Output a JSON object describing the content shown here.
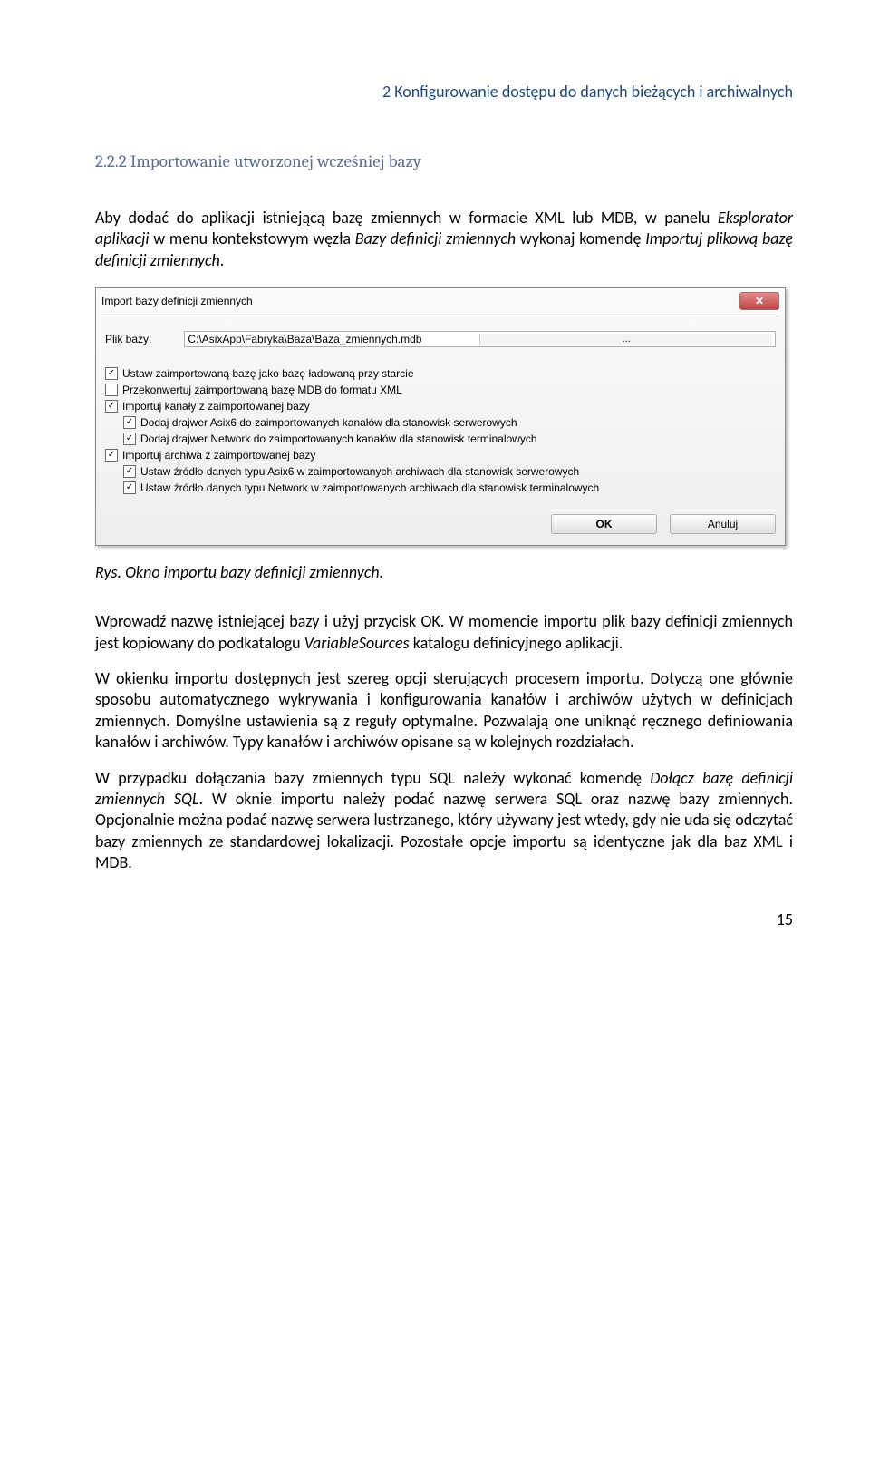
{
  "header": "2 Konfigurowanie dostępu do danych bieżących i archiwalnych",
  "section_title": "2.2.2 Importowanie utworzonej wcześniej bazy",
  "intro": "Aby dodać do aplikacji istniejącą bazę zmiennych w formacie XML lub MDB, w panelu Eksplorator aplikacji w menu kontekstowym węzła Bazy definicji zmiennych wykonaj komendę Importuj plikową bazę definicji zmiennych.",
  "dialog": {
    "title": "Import bazy definicji zmiennych",
    "file_label": "Plik bazy:",
    "file_value": "C:\\AsixApp\\Fabryka\\Baza\\Baza_zmiennych.mdb",
    "browse": "...",
    "options": [
      {
        "checked": true,
        "indent": 0,
        "label": "Ustaw zaimportowaną bazę jako bazę ładowaną przy starcie"
      },
      {
        "checked": false,
        "indent": 0,
        "label": "Przekonwertuj zaimportowaną bazę MDB do formatu XML"
      },
      {
        "checked": true,
        "indent": 0,
        "label": "Importuj kanały z zaimportowanej bazy"
      },
      {
        "checked": true,
        "indent": 1,
        "label": "Dodaj drajwer Asix6 do zaimportowanych kanałów dla stanowisk serwerowych"
      },
      {
        "checked": true,
        "indent": 1,
        "label": "Dodaj drajwer Network do zaimportowanych kanałów dla stanowisk terminalowych"
      },
      {
        "checked": true,
        "indent": 0,
        "label": "Importuj archiwa z zaimportowanej bazy"
      },
      {
        "checked": true,
        "indent": 1,
        "label": "Ustaw źródło danych typu Asix6 w zaimportowanych archiwach dla stanowisk serwerowych"
      },
      {
        "checked": true,
        "indent": 1,
        "label": "Ustaw źródło danych typu Network w zaimportowanych archiwach dla stanowisk terminalowych"
      }
    ],
    "ok": "OK",
    "cancel": "Anuluj"
  },
  "caption": "Rys. Okno importu bazy definicji zmiennych.",
  "para1": "Wprowadź nazwę istniejącej bazy i użyj przycisk OK. W momencie importu plik bazy definicji zmiennych jest kopiowany do podkatalogu VariableSources katalogu definicyjnego aplikacji.",
  "para2": "W okienku importu  dostępnych jest szereg opcji sterujących procesem importu. Dotyczą one głównie sposobu automatycznego wykrywania i konfigurowania kanałów i archiwów użytych w definicjach zmiennych. Domyślne ustawienia są z reguły optymalne. Pozwalają one uniknąć ręcznego definiowania kanałów i archiwów. Typy kanałów i archiwów opisane są w kolejnych rozdziałach.",
  "para3": "W przypadku dołączania bazy zmiennych typu SQL należy wykonać komendę Dołącz bazę definicji zmiennych SQL. W oknie importu należy podać nazwę serwera SQL oraz nazwę bazy zmiennych. Opcjonalnie można podać nazwę serwera lustrzanego, który używany jest wtedy, gdy nie uda się odczytać bazy zmiennych ze standardowej lokalizacji.  Pozostałe opcje importu są identyczne jak dla baz XML i MDB.",
  "page_number": "15"
}
